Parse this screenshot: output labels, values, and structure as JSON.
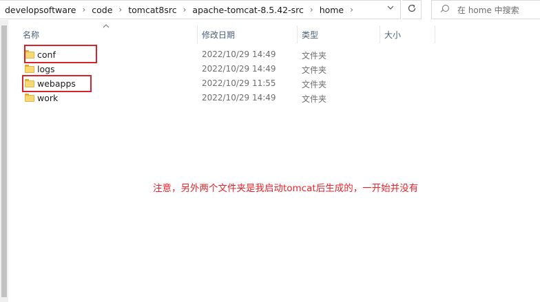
{
  "address_bar": {
    "breadcrumbs": [
      "developsoftware",
      "code",
      "tomcat8src",
      "apache-tomcat-8.5.42-src",
      "home"
    ],
    "separator_icon": "chevron-right-icon",
    "dropdown_icon": "chevron-down-icon",
    "refresh_icon": "refresh-icon"
  },
  "search": {
    "placeholder": "在 home 中搜索",
    "icon": "search-icon"
  },
  "columns": {
    "name": "名称",
    "date_modified": "修改日期",
    "type": "类型",
    "size": "大小",
    "sorted_column": "name",
    "sort_direction": "ascending"
  },
  "files": [
    {
      "name": "conf",
      "date_modified": "2022/10/29 14:49",
      "type": "文件夹",
      "size": "",
      "icon": "folder-icon",
      "highlighted": true
    },
    {
      "name": "logs",
      "date_modified": "2022/10/29 14:49",
      "type": "文件夹",
      "size": "",
      "icon": "folder-icon",
      "highlighted": false
    },
    {
      "name": "webapps",
      "date_modified": "2022/10/29 11:55",
      "type": "文件夹",
      "size": "",
      "icon": "folder-icon",
      "highlighted": true
    },
    {
      "name": "work",
      "date_modified": "2022/10/29 14:49",
      "type": "文件夹",
      "size": "",
      "icon": "folder-icon",
      "highlighted": false
    }
  ],
  "annotation": {
    "text": "注意，另外两个文件夹是我启动tomcat后生成的，一开始并没有",
    "color": "#e8232a"
  },
  "highlight_color": "#d6232b"
}
